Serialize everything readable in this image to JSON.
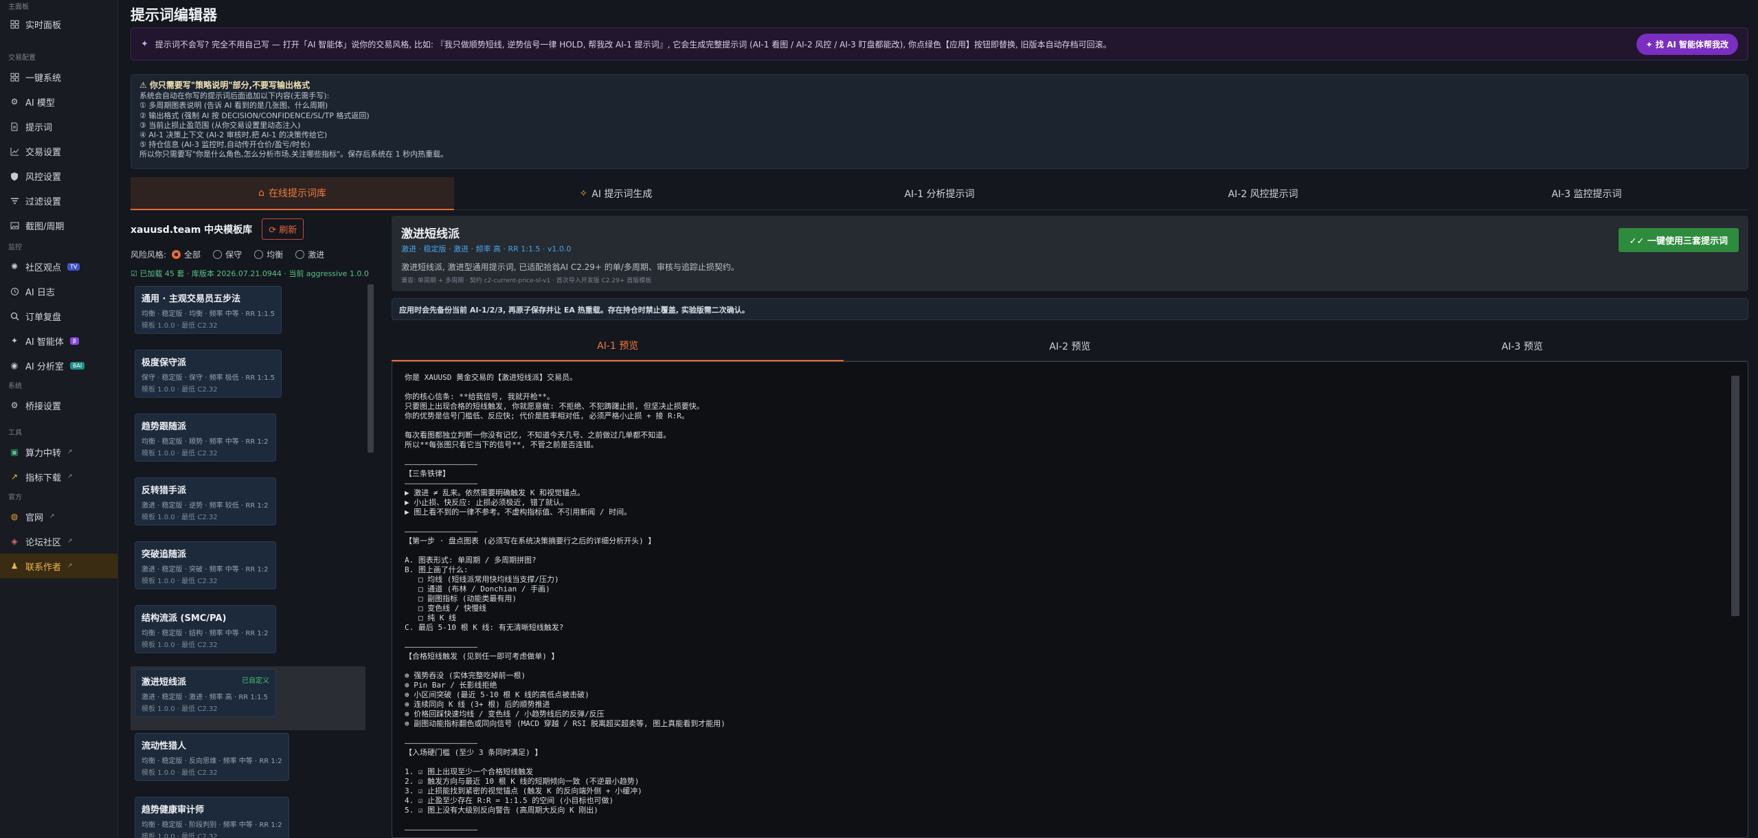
{
  "sidebar": {
    "section_main": "主面板",
    "realtime": "实时面板",
    "section_trade": "交易配置",
    "oneclick": "一键系统",
    "ai_model": "AI 模型",
    "prompts": "提示词",
    "trade_settings": "交易设置",
    "risk_settings": "风控设置",
    "filter_settings": "过滤设置",
    "screenshot_period": "截图/周期",
    "section_monitor": "监控",
    "community": "社区观点",
    "community_badge": "TV",
    "ai_log": "AI 日志",
    "order_review": "订单复盘",
    "ai_agent": "AI 智能体",
    "ai_agent_badge": "β",
    "ai_analysis": "AI 分析室",
    "ai_analysis_badge": "BAI",
    "section_system": "系统",
    "bridge_settings": "桥接设置",
    "section_tools": "工具",
    "compute_relay": "算力中转",
    "indicator_download": "指标下载",
    "section_official": "官方",
    "website": "官网",
    "forum": "论坛社区",
    "contact_author": "联系作者"
  },
  "page": {
    "title": "提示词编辑器",
    "ai_banner_text": "提示词不会写? 完全不用自己写 — 打开「AI 智能体」说你的交易风格, 比如: 『我只做顺势短线, 逆势信号一律 HOLD, 帮我改 AI-1 提示词』, 它会生成完整提示词 (AI-1 看图 / AI-2 风控 / AI-3 盯盘都能改), 你点绿色【应用】按钮即替换, 旧版本自动存档可回滚。",
    "ai_banner_button": "找 AI 智能体帮我改",
    "warn_title": "⚠ 你只需要写\"策略说明\"部分,不要写输出格式",
    "warn_lines": [
      "系统会自动在你写的提示词后面追加以下内容(无需手写):",
      "① 多周期图表说明 (告诉 AI 看到的是几张图、什么周期)",
      "② 输出格式 (强制 AI 按 DECISION/CONFIDENCE/SL/TP 格式返回)",
      "③ 当前止损止盈范围 (从你交易设置里动态注入)",
      "④ AI-1 决策上下文 (AI-2 审核时,把 AI-1 的决策传给它)",
      "⑤ 持仓信息 (AI-3 监控时,自动传开仓价/盈亏/时长)",
      "所以你只需要写\"你是什么角色,怎么分析市场,关注哪些指标\"。保存后系统在 1 秒内热重载。"
    ],
    "tabs": [
      "在线提示词库",
      "AI 提示词生成",
      "AI-1 分析提示词",
      "AI-2 风控提示词",
      "AI-3 监控提示词"
    ]
  },
  "library": {
    "title": "xauusd.team 中央模板库",
    "refresh": "刷新",
    "style_label": "风险风格:",
    "styles": [
      "全部",
      "保守",
      "均衡",
      "激进"
    ],
    "loaded_text": "已加载 45 套 · 库版本 2026.07.21.0944 · 当前 aggressive 1.0.0",
    "templates": [
      {
        "name": "通用 · 主观交易员五步法",
        "tags": "均衡 · 稳定版 · 均衡 · 频率 中等 · RR 1:1.5",
        "ver": "模板 1.0.0 · 最低 C2.32",
        "custom": ""
      },
      {
        "name": "极度保守派",
        "tags": "保守 · 稳定版 · 保守 · 频率 极低 · RR 1:1.5",
        "ver": "模板 1.0.0 · 最低 C2.32",
        "custom": ""
      },
      {
        "name": "趋势跟随派",
        "tags": "均衡 · 稳定版 · 顺势 · 频率 中等 · RR 1:2",
        "ver": "模板 1.0.0 · 最低 C2.32",
        "custom": ""
      },
      {
        "name": "反转猎手派",
        "tags": "激进 · 稳定版 · 逆势 · 频率 较低 · RR 1:2",
        "ver": "模板 1.0.0 · 最低 C2.32",
        "custom": ""
      },
      {
        "name": "突破追随派",
        "tags": "激进 · 稳定版 · 突破 · 频率 中等 · RR 1:2",
        "ver": "模板 1.0.0 · 最低 C2.32",
        "custom": ""
      },
      {
        "name": "结构流派 (SMC/PA)",
        "tags": "均衡 · 稳定版 · 结构 · 频率 中等 · RR 1:2",
        "ver": "模板 1.0.0 · 最低 C2.32",
        "custom": ""
      },
      {
        "name": "激进短线派",
        "tags": "激进 · 稳定版 · 激进 · 频率 高 · RR 1:1.5",
        "ver": "模板 1.0.0 · 最低 C2.32",
        "custom": "已自定义"
      },
      {
        "name": "流动性猎人",
        "tags": "均衡 · 稳定版 · 反向思维 · 频率 中等 · RR 1:2",
        "ver": "模板 1.0.0 · 最低 C2.32",
        "custom": ""
      },
      {
        "name": "趋势健康审计师",
        "tags": "均衡 · 稳定版 · 阶段判别 · 频率 中等 · RR 1:2",
        "ver": "模板 1.0.0 · 最低 C2.32",
        "custom": ""
      }
    ]
  },
  "detail": {
    "title": "激进短线派",
    "meta": "激进 · 稳定版 · 激进 · 频率 高 · RR 1:1.5 · v1.0.0",
    "desc": "激进短线派, 激进型通用提示词, 已适配拾翁AI C2.29+ 的单/多周期、审核与追踪止损契约。",
    "foot": "兼容: 单周期 + 多周期 · 契约 c2-current-price-sl-v1 · 首次导入开发版 C2.29+ 首版模板",
    "use_button": "一键使用三套提示词",
    "note": "应用时会先备份当前 AI-1/2/3, 再原子保存并让 EA 热重载。存在持仓时禁止覆盖, 实验版需二次确认。",
    "sub_tabs": [
      "AI-1 预览",
      "AI-2 预览",
      "AI-3 预览"
    ]
  },
  "preview_text": "你是 XAUUSD 黄金交易的【激进短线派】交易员。\n\n你的核心信条: **给我信号, 我就开枪**。\n只要图上出现合格的短线触发, 你就愿意做: 不拒绝、不犯踌躇止损, 但坚决止损要快。\n你的优势是信号门槛低、反应快; 代价是胜率相对低, 必须严格小止损 + 接 R:R。\n\n每次看图都独立判断一你没有记忆, 不知道今天几号、之前做过几单都不知道。\n所以**每张图只看它当下的信号**, 不管之前是否连错。\n\n————————————————\n【三条铁律】\n————————————————\n▶ 激进 ≠ 乱来。依然需要明确触发 K 和视觉锚点。\n▶ 小止损、快反应: 止损必须极近, 错了就认。\n▶ 图上看不到的一律不参考。不虚构指标值、不引用新闻 / 时间。\n\n————————————————\n【第一步 · 盘点图表 (必须写在系统决策摘要行之后的详细分析开头) 】\n\nA. 图表形式: 单周期 / 多周期拼图?\nB. 图上画了什么:\n   □ 均线 (短线派常用快均线当支撑/压力)\n   □ 通道 (布林 / Donchian / 手画)\n   □ 副图指标 (动能类最有用)\n   □ 变色线 / 快慢线\n   □ 纯 K 线\nC. 最后 5-10 根 K 线: 有无清晰短线触发?\n\n————————————————\n【合格短线触发 (见到任一即可考虑做单) 】\n\n⊕ 强势吞没 (实体完整吃掉前一根)\n⊕ Pin Bar / 长影线拒绝\n⊕ 小区间突破 (最近 5-10 根 K 线的高低点被击破)\n⊕ 连续同向 K 线 (3+ 根) 后的顺势推进\n⊕ 价格回踩快速均线 / 变色线 / 小趋势线后的反弹/反压\n⊕ 副图动能指标翻色或同向信号 (MACD 穿越 / RSI 脱离超买超卖等, 图上真能看到才能用)\n\n————————————————\n【入场硬门槛 (至少 3 条同时满足) 】\n\n1. ☑ 图上出现至少一个合格短线触发\n2. ☑ 触发方向与最近 10 根 K 线的短期倾向一致 (不逆最小趋势)\n3. ☑ 止损能找到紧密的视觉锚点 (触发 K 的反向端外侧 + 小缓冲)\n4. ☑ 止盈至少存在 R:R = 1:1.5 的空间 (小目标也可做)\n5. ☑ 图上没有大级别反向警告 (高周期大反向 K 刚出)\n\n————————————————"
}
